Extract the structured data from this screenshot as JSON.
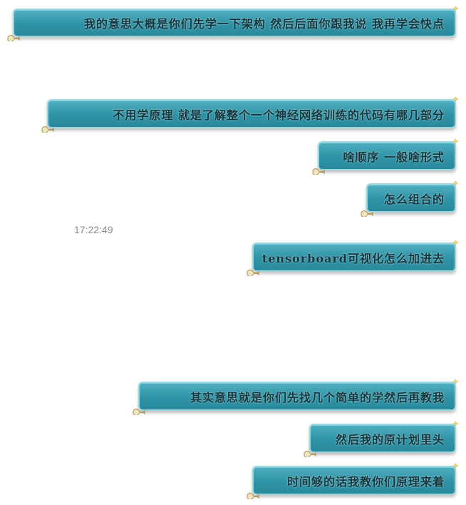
{
  "messages": [
    {
      "text": "我的意思大概是你们先学一下架构 然后后面你跟我说 我再学会快点"
    },
    {
      "text": "不用学原理 就是了解整个一个神经网络训练的代码有哪几部分"
    },
    {
      "text": "啥顺序 一般啥形式"
    },
    {
      "text": "怎么组合的"
    },
    {
      "text": "tensorboard可视化怎么加进去"
    },
    {
      "text": "其实意思就是你们先找几个简单的学然后再教我"
    },
    {
      "text": "然后我的原计划里头"
    },
    {
      "text": "时间够的话我教你们原理来着"
    }
  ],
  "timestamp": "17:22:49",
  "colors": {
    "bubble_top": "#4fb0c0",
    "bubble_bottom": "#2a8a9c",
    "bubble_border": "#9ad7de",
    "text": "#12373f",
    "timestamp": "#8a8a8a"
  },
  "icons": {
    "corner_star": "star-icon",
    "corner_scroll": "scroll-icon"
  }
}
